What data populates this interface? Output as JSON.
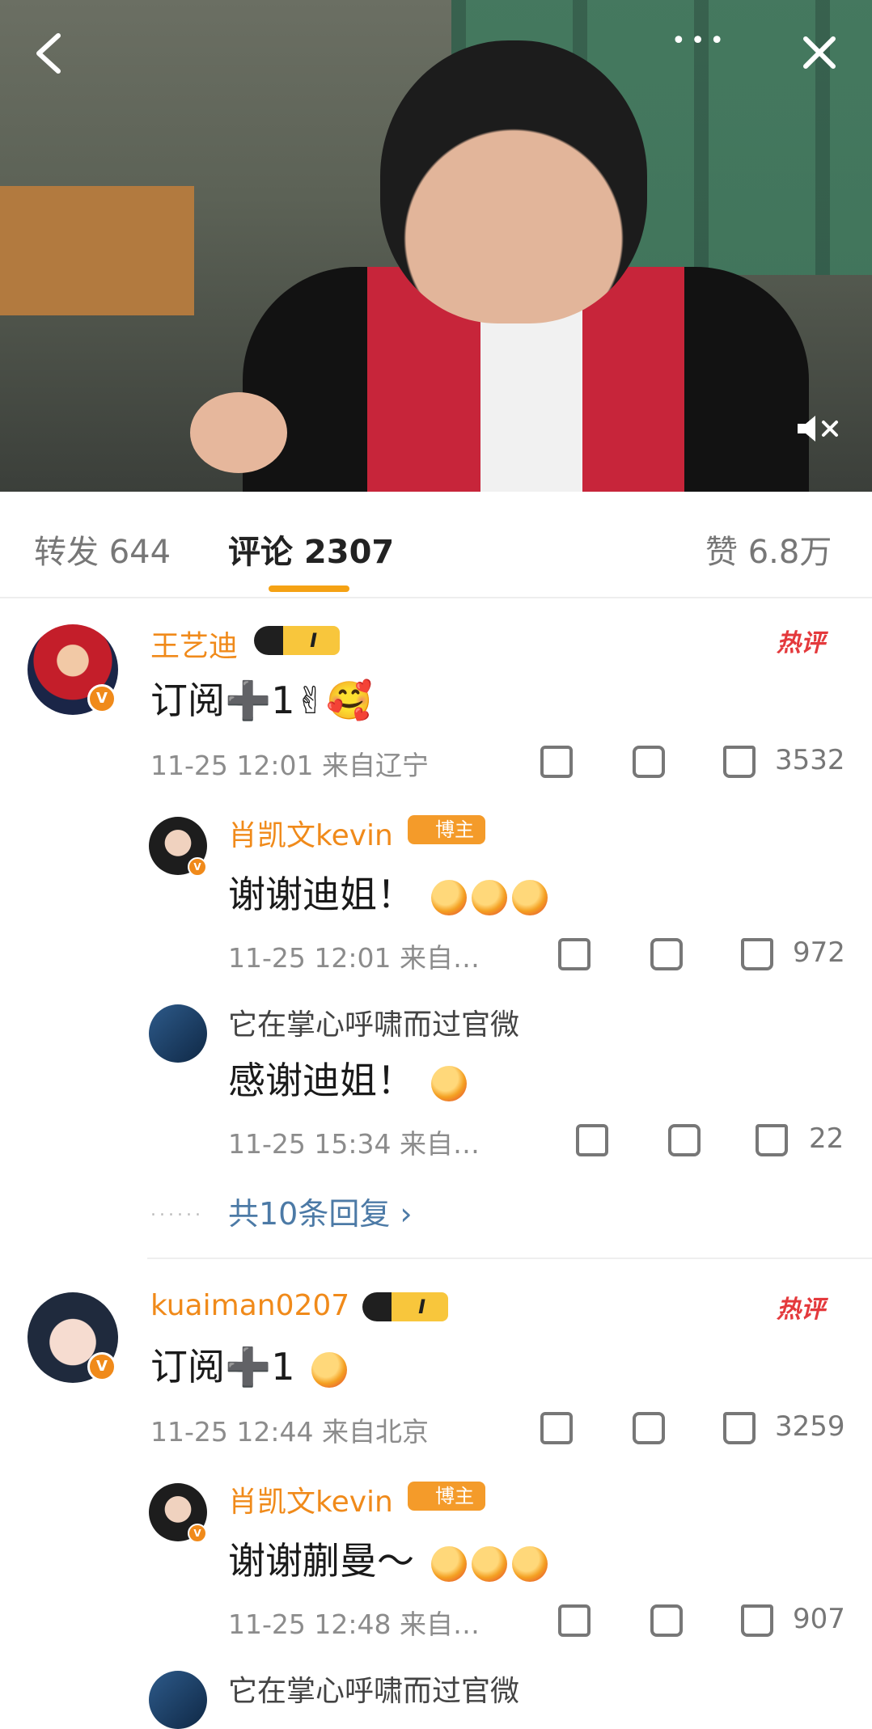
{
  "header": {
    "more": "•••",
    "close": "✕",
    "back": "‹",
    "mute": "🔇"
  },
  "tabs": {
    "repost": "转发 644",
    "comments": "评论 2307",
    "likes": "赞 6.8万"
  },
  "comments": [
    {
      "name": "王艺迪",
      "text": "订阅➕1✌🥰",
      "meta": "11-25 12:01 来自辽宁",
      "hot": "热评",
      "likes": "3532",
      "replies": [
        {
          "name": "肖凯文kevin",
          "text": "谢谢迪姐！",
          "meta": "11-25 12:01 来自…",
          "likes": "972"
        },
        {
          "name": "它在掌心呼啸而过官微",
          "text": "感谢迪姐！",
          "meta": "11-25 15:34 来自…",
          "likes": "22"
        }
      ],
      "more_replies": "共10条回复 ›"
    },
    {
      "name": "kuaiman0207",
      "text": "订阅➕1",
      "meta": "11-25 12:44 来自北京",
      "hot": "热评",
      "likes": "3259",
      "replies": [
        {
          "name": "肖凯文kevin",
          "text": "谢谢蒯曼～",
          "meta": "11-25 12:48 来自…",
          "likes": "907"
        },
        {
          "name": "它在掌心呼啸而过官微"
        }
      ]
    }
  ],
  "badges": {
    "crown_level": "I",
    "blogger": "博主",
    "verified": "V"
  }
}
